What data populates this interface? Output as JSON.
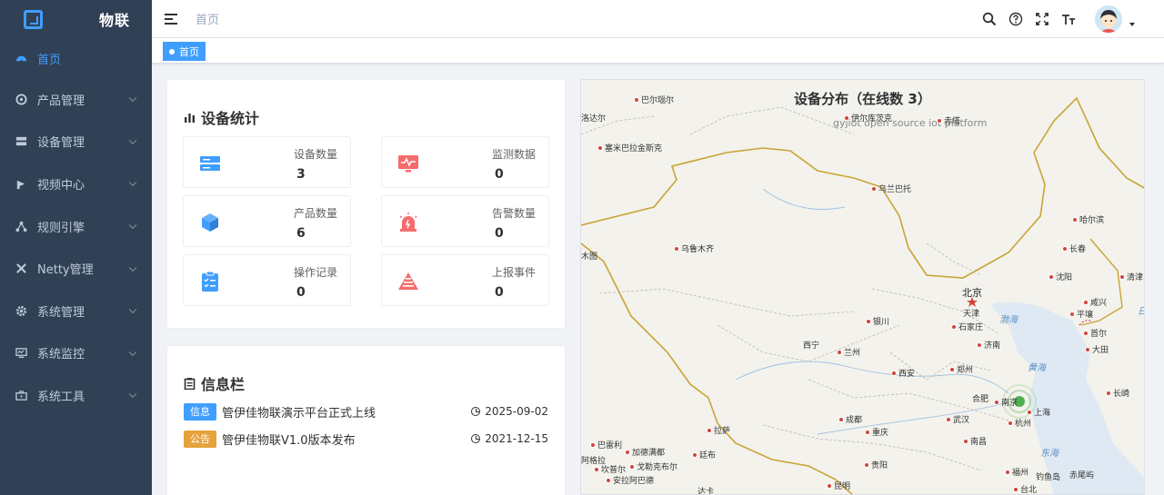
{
  "sidebar": {
    "brand": "物联",
    "items": [
      {
        "label": "首页",
        "icon": "dashboard-icon",
        "active": true
      },
      {
        "label": "产品管理",
        "icon": "product-icon"
      },
      {
        "label": "设备管理",
        "icon": "device-icon"
      },
      {
        "label": "视频中心",
        "icon": "video-icon"
      },
      {
        "label": "规则引擎",
        "icon": "rule-icon"
      },
      {
        "label": "Netty管理",
        "icon": "netty-icon"
      },
      {
        "label": "系统管理",
        "icon": "system-icon"
      },
      {
        "label": "系统监控",
        "icon": "monitor-icon"
      },
      {
        "label": "系统工具",
        "icon": "tools-icon"
      }
    ]
  },
  "navbar": {
    "breadcrumb": "首页",
    "icons": [
      "search-icon",
      "help-icon",
      "fullscreen-icon",
      "font-size-icon"
    ]
  },
  "tagsview": {
    "tags": [
      "首页"
    ]
  },
  "stats": {
    "title": "设备统计",
    "items": [
      {
        "label": "设备数量",
        "value": "3",
        "icon": "server-icon",
        "color": "#409eff"
      },
      {
        "label": "监测数据",
        "value": "0",
        "icon": "monitor-screen-icon",
        "color": "#f56c6c"
      },
      {
        "label": "产品数量",
        "value": "6",
        "icon": "cube-icon",
        "color": "#409eff"
      },
      {
        "label": "告警数量",
        "value": "0",
        "icon": "alarm-icon",
        "color": "#f56c6c"
      },
      {
        "label": "操作记录",
        "value": "0",
        "icon": "clipboard-icon",
        "color": "#409eff"
      },
      {
        "label": "上报事件",
        "value": "0",
        "icon": "warning-icon",
        "color": "#f56c6c"
      }
    ]
  },
  "notices": {
    "title": "信息栏",
    "items": [
      {
        "badge": "信息",
        "badge_color": "#409eff",
        "text": "管伊佳物联演示平台正式上线",
        "date": "2025-09-02"
      },
      {
        "badge": "公告",
        "badge_color": "#e6a23c",
        "text": "管伊佳物联V1.0版本发布",
        "date": "2021-12-15"
      }
    ]
  },
  "map": {
    "title": "设备分布（在线数 3）",
    "subtitle": "gyjiot open source iot platform",
    "capital": "北京",
    "cities": [
      "巴尔瑙尔",
      "洛达尔",
      "塞米巴拉金斯克",
      "伊尔库茨克",
      "赤塔",
      "乌兰巴托",
      "哈尔滨",
      "长春",
      "乌鲁木齐",
      "木图",
      "沈阳",
      "清津",
      "天津",
      "石家庄",
      "咸兴",
      "平壤",
      "首尔",
      "大田",
      "银川",
      "济南",
      "西宁",
      "兰州",
      "西安",
      "郑州",
      "合肥",
      "南京",
      "上海",
      "长崎",
      "成都",
      "武汉",
      "杭州",
      "拉萨",
      "重庆",
      "南昌",
      "巴雷利",
      "加德满都",
      "廷布",
      "阿格拉",
      "戈勒克布尔",
      "坎普尔",
      "安拉阿巴德",
      "贵阳",
      "福州",
      "钓鱼岛",
      "赤尾屿",
      "台北",
      "昆明",
      "达卡"
    ],
    "seas": [
      "渤海",
      "黄海",
      "东海",
      "日"
    ]
  }
}
